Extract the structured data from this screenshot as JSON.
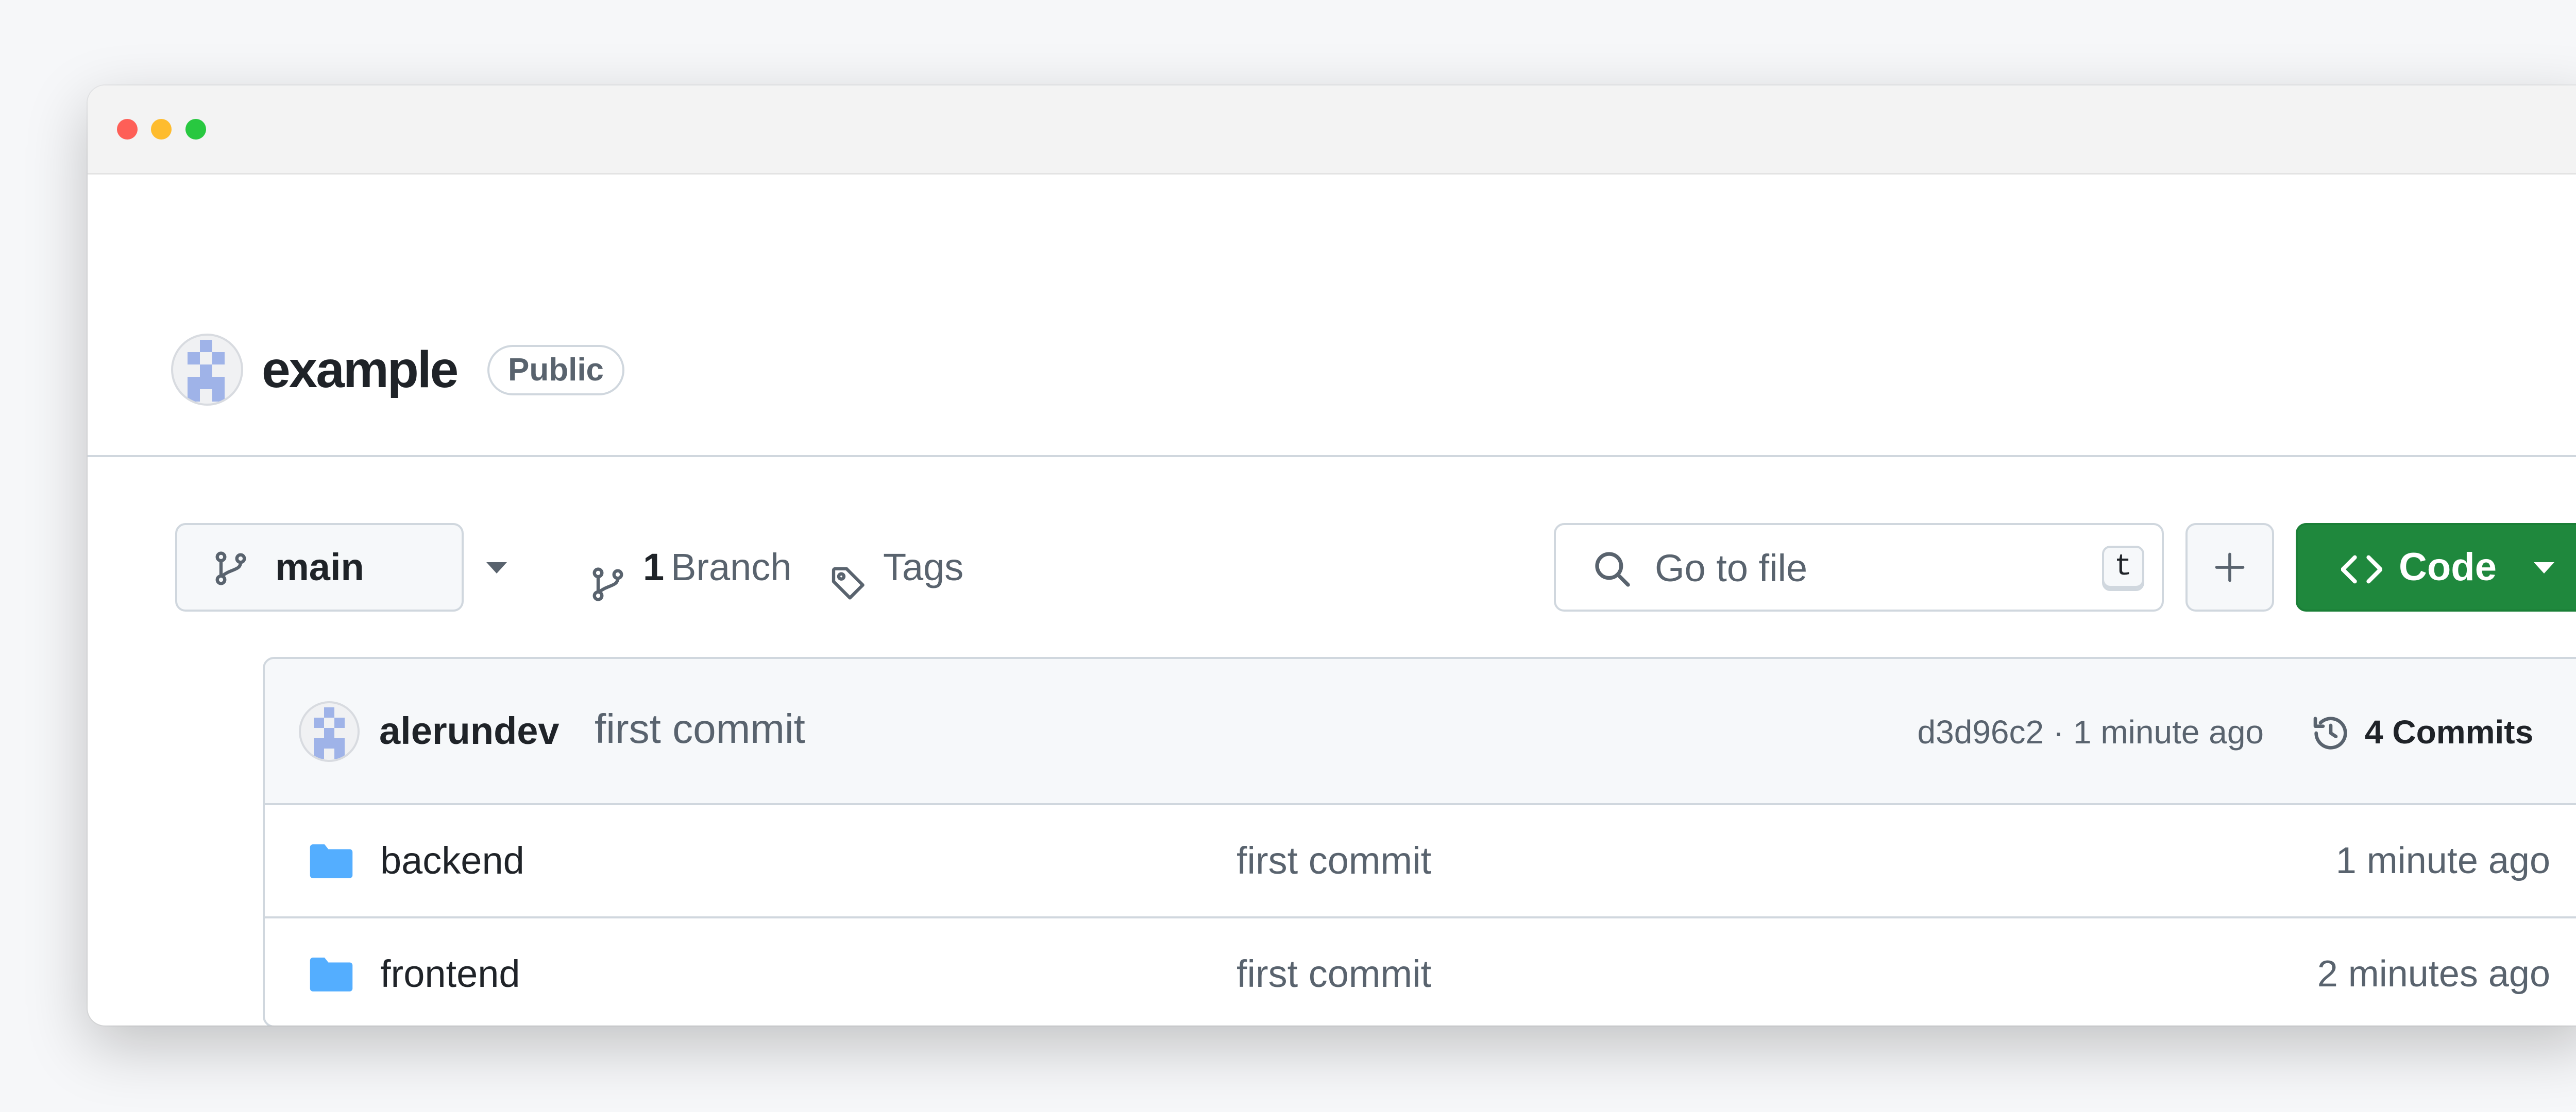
{
  "window": {
    "controls": [
      "close",
      "minimize",
      "maximize"
    ]
  },
  "repo": {
    "name": "example",
    "visibility": "Public",
    "owner_avatar_icon": "identicon-avatar"
  },
  "toolbar": {
    "branch": "main",
    "branch_count": "1",
    "branch_label": "Branch",
    "tags_label": "Tags",
    "search_placeholder": "Go to file",
    "search_shortcut": "t",
    "add_icon": "plus-icon",
    "code_label": "Code"
  },
  "latest_commit": {
    "author": "alerundev",
    "message": "first commit",
    "meta": "d3d96c2 · 1 minute ago",
    "commits_label": "4 Commits"
  },
  "files": [
    {
      "name": "backend",
      "type": "folder",
      "commit": "first commit",
      "age": "1 minute ago"
    },
    {
      "name": "frontend",
      "type": "folder",
      "commit": "first commit",
      "age": "2 minutes ago"
    }
  ],
  "colors": {
    "primary_button": "#1f883d",
    "folder": "#54aeff",
    "border": "#d0d7de",
    "muted_text": "#59636e"
  }
}
